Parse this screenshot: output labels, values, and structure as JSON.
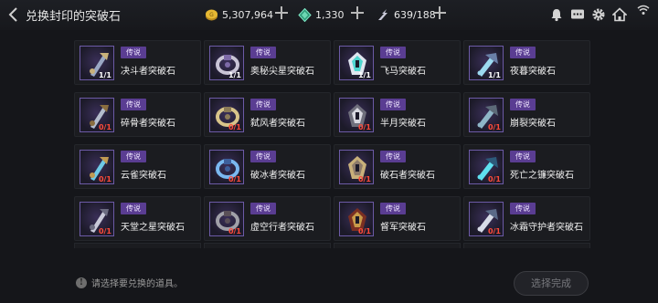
{
  "header": {
    "title": "兑换封印的突破石",
    "gold": "5,307,964",
    "gems": "1,330",
    "stamina": "639/188"
  },
  "items": [
    {
      "tag": "传说",
      "name": "决斗者突破石",
      "count": "1/1",
      "owned": true,
      "icon": "dual-blade-icon"
    },
    {
      "tag": "传说",
      "name": "奥秘尖星突破石",
      "count": "1/1",
      "owned": true,
      "icon": "ring-bracelet-icon"
    },
    {
      "tag": "传说",
      "name": "飞马突破石",
      "count": "1/1",
      "owned": true,
      "icon": "winged-armor-icon"
    },
    {
      "tag": "传说",
      "name": "夜暮突破石",
      "count": "1/1",
      "owned": true,
      "icon": "twin-gauntlet-icon"
    },
    {
      "tag": "传说",
      "name": "碎骨者突破石",
      "count": "0/1",
      "owned": false,
      "icon": "bone-axe-icon"
    },
    {
      "tag": "传说",
      "name": "弑风者突破石",
      "count": "0/1",
      "owned": false,
      "icon": "wind-sword-icon"
    },
    {
      "tag": "传说",
      "name": "半月突破石",
      "count": "0/1",
      "owned": false,
      "icon": "halfmoon-axe-icon"
    },
    {
      "tag": "传说",
      "name": "崩裂突破石",
      "count": "0/1",
      "owned": false,
      "icon": "crossbow-icon"
    },
    {
      "tag": "传说",
      "name": "云雀突破石",
      "count": "0/1",
      "owned": false,
      "icon": "lark-blade-icon"
    },
    {
      "tag": "传说",
      "name": "破冰者突破石",
      "count": "0/1",
      "owned": false,
      "icon": "ice-helm-icon"
    },
    {
      "tag": "传说",
      "name": "破石者突破石",
      "count": "0/1",
      "owned": false,
      "icon": "stone-armor-icon"
    },
    {
      "tag": "传说",
      "name": "死亡之镰突破石",
      "count": "0/1",
      "owned": false,
      "icon": "death-scythe-icon"
    },
    {
      "tag": "传说",
      "name": "天堂之星突破石",
      "count": "0/1",
      "owned": false,
      "icon": "heaven-knight-icon"
    },
    {
      "tag": "传说",
      "name": "虚空行者突破石",
      "count": "0/1",
      "owned": false,
      "icon": "void-walker-icon"
    },
    {
      "tag": "传说",
      "name": "督军突破石",
      "count": "0/1",
      "owned": false,
      "icon": "warlord-icon"
    },
    {
      "tag": "传说",
      "name": "冰霜守护者突破石",
      "count": "0/1",
      "owned": false,
      "icon": "frost-guardian-icon"
    }
  ],
  "footer": {
    "hint": "请选择要兑换的道具。",
    "confirm_label": "选择完成"
  },
  "colors": {
    "tag_bg": "#5a3d92",
    "count_zero": "#ff4a3a",
    "thumb_border": "#6c5aa6"
  }
}
